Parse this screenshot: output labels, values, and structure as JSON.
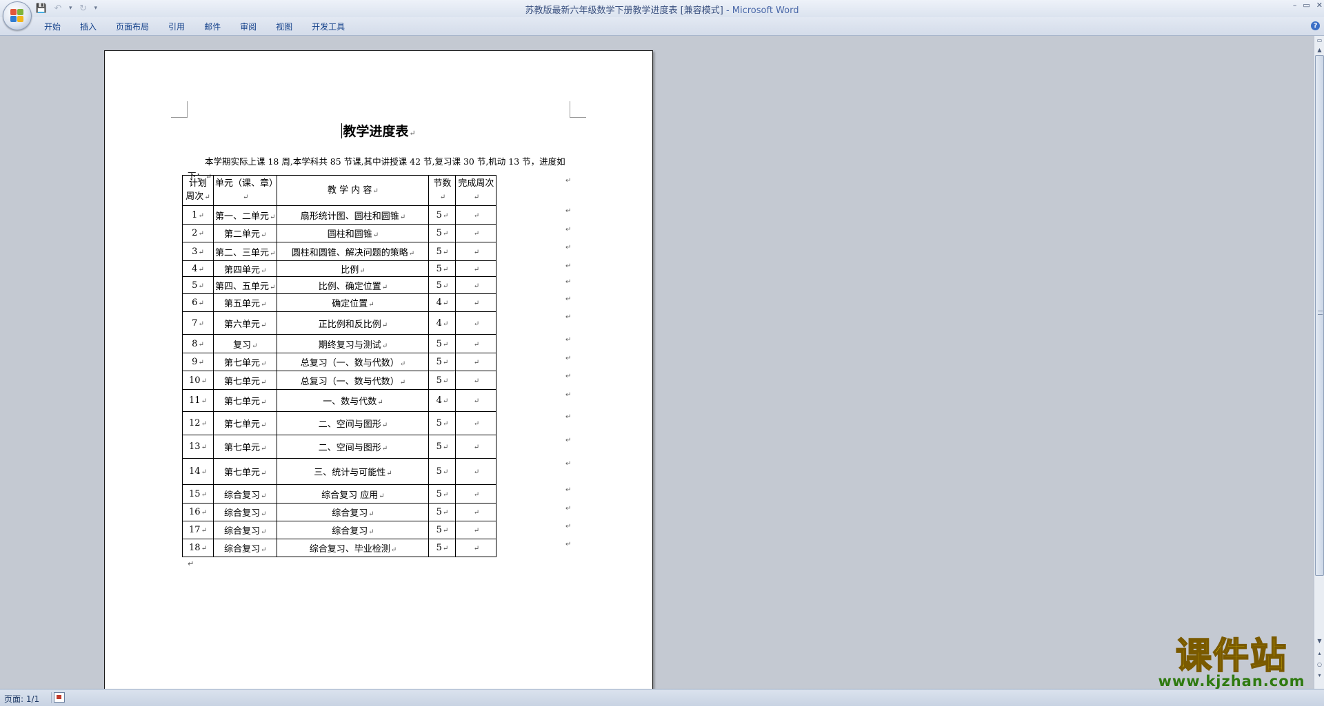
{
  "window": {
    "title": "苏教版最新六年级数学下册教学进度表 [兼容模式]",
    "app_name": "- Microsoft Word",
    "controls": [
      "–",
      "▭",
      "✕"
    ]
  },
  "quick_access": {
    "icons": [
      "save-icon",
      "undo-icon",
      "redo-icon",
      "customize-icon"
    ],
    "glyphs": {
      "save": "💾",
      "undo": "↶",
      "redo": "↻",
      "customize": "▾"
    }
  },
  "ribbon": {
    "tabs": [
      "开始",
      "插入",
      "页面布局",
      "引用",
      "邮件",
      "审阅",
      "视图",
      "开发工具"
    ],
    "help": "?"
  },
  "document": {
    "title": "教学进度表",
    "intro": "本学期实际上课 18 周,本学科共 85 节课,其中讲授课 42 节,复习课 30 节,机动  13 节，进度如下：",
    "mark": "↵",
    "table": {
      "headers": [
        "计划\n周次",
        "单元（课、章）",
        "教  学  内  容",
        "节数",
        "完成周次"
      ],
      "rows": [
        [
          "1",
          "第一、二单元",
          "扇形统计图、圆柱和圆锥",
          "5",
          ""
        ],
        [
          "2",
          "第二单元",
          "圆柱和圆锥",
          "5",
          ""
        ],
        [
          "3",
          "第二、三单元",
          "圆柱和圆锥、解决问题的策略",
          "5",
          ""
        ],
        [
          "4",
          "第四单元",
          "比例",
          "5",
          ""
        ],
        [
          "5",
          "第四、五单元",
          "比例、确定位置",
          "5",
          ""
        ],
        [
          "6",
          "第五单元",
          "确定位置",
          "4",
          ""
        ],
        [
          "7",
          "第六单元",
          "正比例和反比例",
          "4",
          ""
        ],
        [
          "8",
          "复习",
          "期终复习与测试",
          "5",
          ""
        ],
        [
          "9",
          "第七单元",
          "总复习（一、数与代数）",
          "5",
          ""
        ],
        [
          "10",
          "第七单元",
          "总复习（一、数与代数）",
          "5",
          ""
        ],
        [
          "11",
          "第七单元",
          "一、数与代数",
          "4",
          ""
        ],
        [
          "12",
          "第七单元",
          "二、空间与图形",
          "5",
          ""
        ],
        [
          "13",
          "第七单元",
          "二、空间与图形",
          "5",
          ""
        ],
        [
          "14",
          "第七单元",
          "三、统计与可能性",
          "5",
          ""
        ],
        [
          "15",
          "综合复习",
          "综合复习  应用",
          "5",
          ""
        ],
        [
          "16",
          "综合复习",
          "综合复习",
          "5",
          ""
        ],
        [
          "17",
          "综合复习",
          "综合复习",
          "5",
          ""
        ],
        [
          "18",
          "综合复习",
          "综合复习、毕业检测",
          "5",
          ""
        ]
      ]
    }
  },
  "status_bar": {
    "page_count": "页面: 1/1"
  },
  "watermark": {
    "text": "课件站",
    "url": "www.kjzhan.com"
  },
  "colors": {
    "accent": "#15428b",
    "title_text": "#3c5280",
    "watermark_yellow": "#f3d70a",
    "watermark_green": "#2f7a10"
  }
}
